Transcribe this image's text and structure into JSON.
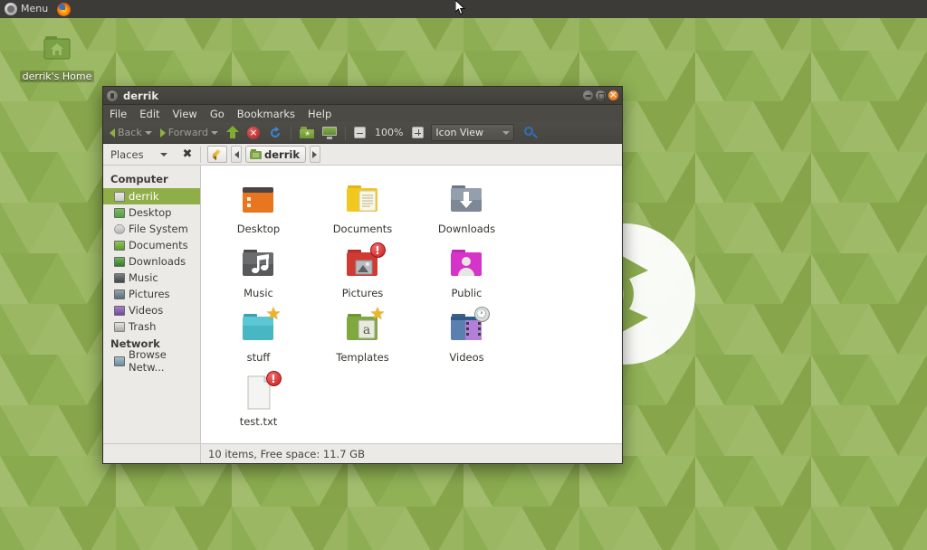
{
  "panel": {
    "menu_label": "Menu",
    "menu_icon": "ubuntu-mate-menu-icon",
    "firefox_icon": "firefox-icon"
  },
  "desktop": {
    "icons": [
      {
        "label": "derrik's Home",
        "icon": "home-folder-icon"
      }
    ],
    "wallpaper": {
      "description": "green triangle tessellation with white circular logo",
      "colors": [
        "#9cb85f",
        "#8aab4e",
        "#7da043",
        "#a8c16d",
        "#6f9239"
      ]
    },
    "cursor_icon": "mouse-pointer-icon"
  },
  "window": {
    "title": "derrik",
    "title_icon": "file-manager-icon",
    "buttons": {
      "minimize": "minimize-button",
      "maximize": "maximize-button",
      "close": "close-button"
    },
    "menubar": [
      "File",
      "Edit",
      "View",
      "Go",
      "Bookmarks",
      "Help"
    ],
    "toolbar": {
      "back_label": "Back",
      "forward_label": "Forward",
      "up_icon": "up-arrow-icon",
      "stop_icon": "stop-icon",
      "reload_icon": "reload-icon",
      "home_icon": "home-folder-icon",
      "computer_icon": "computer-icon",
      "zoom_out_icon": "zoom-out-icon",
      "zoom_level": "100%",
      "zoom_in_icon": "zoom-in-icon",
      "view_mode": "Icon View",
      "search_icon": "search-icon"
    },
    "placesbar": {
      "places_label": "Places",
      "close_icon": "close-places-icon",
      "edit_icon": "edit-location-icon",
      "prev_icon": "path-prev-icon",
      "next_icon": "path-next-icon",
      "breadcrumb": "derrik",
      "breadcrumb_icon": "folder-icon"
    },
    "sidebar": {
      "sections": [
        {
          "title": "Computer",
          "items": [
            {
              "label": "derrik",
              "icon": "home-folder-icon",
              "selected": true,
              "color": "#8fae47"
            },
            {
              "label": "Desktop",
              "icon": "desktop-icon",
              "selected": false,
              "color": "#4f9f4a"
            },
            {
              "label": "File System",
              "icon": "drive-icon",
              "selected": false,
              "color": "#b8bcbe"
            },
            {
              "label": "Documents",
              "icon": "documents-icon",
              "selected": false,
              "color": "#6fae3c"
            },
            {
              "label": "Downloads",
              "icon": "downloads-icon",
              "selected": false,
              "color": "#3f8e3a"
            },
            {
              "label": "Music",
              "icon": "music-icon",
              "selected": false,
              "color": "#53575a"
            },
            {
              "label": "Pictures",
              "icon": "pictures-icon",
              "selected": false,
              "color": "#6d7c86"
            },
            {
              "label": "Videos",
              "icon": "videos-icon",
              "selected": false,
              "color": "#8a5fb0"
            },
            {
              "label": "Trash",
              "icon": "trash-icon",
              "selected": false,
              "color": "#a9a9a4"
            }
          ]
        },
        {
          "title": "Network",
          "items": [
            {
              "label": "Browse Netw...",
              "icon": "network-icon",
              "selected": false,
              "color": "#7f9fb5"
            }
          ]
        }
      ]
    },
    "files": [
      {
        "label": "Desktop",
        "icon": "desktop-window-icon",
        "type": "folder",
        "body": "#e8761f",
        "tab": "#d4641a",
        "badge": "none"
      },
      {
        "label": "Documents",
        "icon": "documents-folder-icon",
        "type": "folder",
        "body": "#f2c81e",
        "tab": "#e0b516",
        "badge": "none"
      },
      {
        "label": "Downloads",
        "icon": "downloads-folder-icon",
        "type": "folder",
        "body": "#7d8796",
        "tab": "#6d7684",
        "badge": "none"
      },
      {
        "label": "Music",
        "icon": "music-folder-icon",
        "type": "folder",
        "body": "#58595b",
        "tab": "#4a4b4d",
        "badge": "none"
      },
      {
        "label": "Pictures",
        "icon": "pictures-folder-icon",
        "type": "folder",
        "body": "#cf3a33",
        "tab": "#b52f29",
        "badge": "error"
      },
      {
        "label": "Public",
        "icon": "public-folder-icon",
        "type": "folder",
        "body": "#d633c8",
        "tab": "#c02ab3",
        "badge": "none"
      },
      {
        "label": "stuff",
        "icon": "stuff-folder-icon",
        "type": "folder",
        "body": "#49b6c4",
        "tab": "#3ba1ae",
        "badge": "star"
      },
      {
        "label": "Templates",
        "icon": "templates-folder-icon",
        "type": "folder",
        "body": "#7fa83f",
        "tab": "#6e9434",
        "badge": "star"
      },
      {
        "label": "Videos",
        "icon": "videos-folder-icon",
        "type": "folder",
        "body": "#5b7fae",
        "tab": "#4d6e99",
        "badge": "clock"
      },
      {
        "label": "test.txt",
        "icon": "text-file-icon",
        "type": "file",
        "body": "#f2f2f0",
        "tab": "#dcdcd8",
        "badge": "error"
      }
    ],
    "statusbar": {
      "text": "10 items, Free space: 11.7 GB"
    }
  }
}
